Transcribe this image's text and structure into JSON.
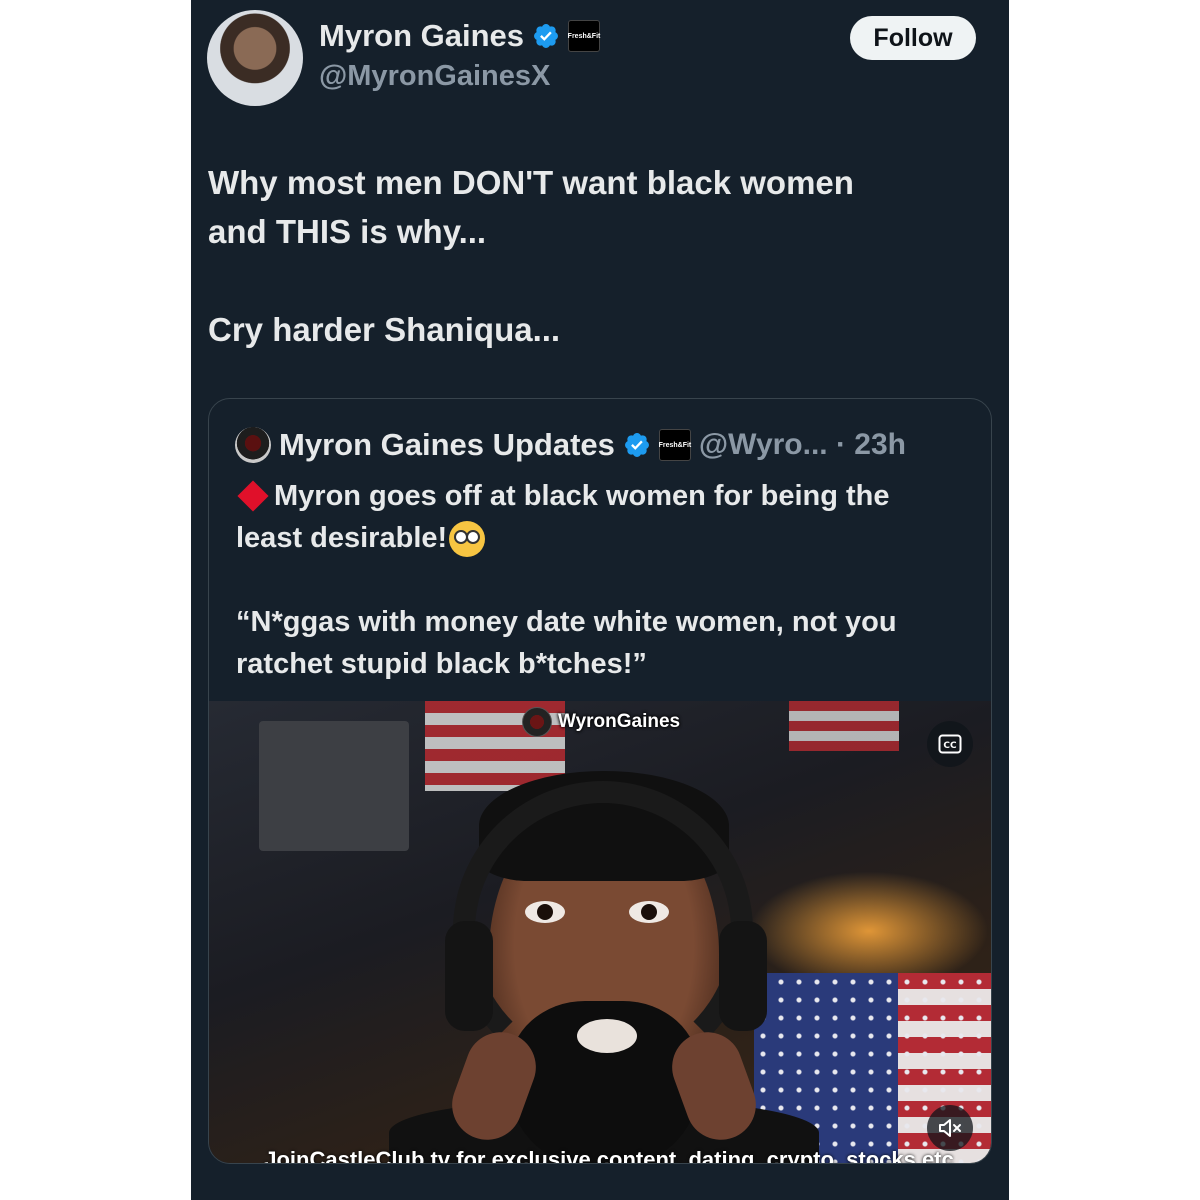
{
  "author": {
    "name": "Myron Gaines",
    "handle": "@MyronGainesX",
    "affiliate_badge": "Fresh&Fit"
  },
  "follow_label": "Follow",
  "tweet": {
    "line1": "Why most men DON'T want black women",
    "line2": "and THIS is why...",
    "line3": "Cry harder Shaniqua..."
  },
  "quote": {
    "name": "Myron Gaines Updates",
    "affiliate_badge": "Fresh&Fit",
    "handle_time": "@Wyro... · 23h",
    "text1": "Myron goes off at black women for being the least desirable!",
    "text2": "“N*ggas with money date white women, not you ratchet stupid black b*tches!”"
  },
  "video": {
    "watermark": "WyronGaines",
    "caption": "JoinCastleClub.tv for exclusive content, dating, crypto, stocks etc"
  },
  "colors": {
    "background": "#15202b",
    "text": "#e7e9ea",
    "muted": "#8b98a5",
    "verified": "#1d9bf0",
    "border": "#38444d"
  }
}
